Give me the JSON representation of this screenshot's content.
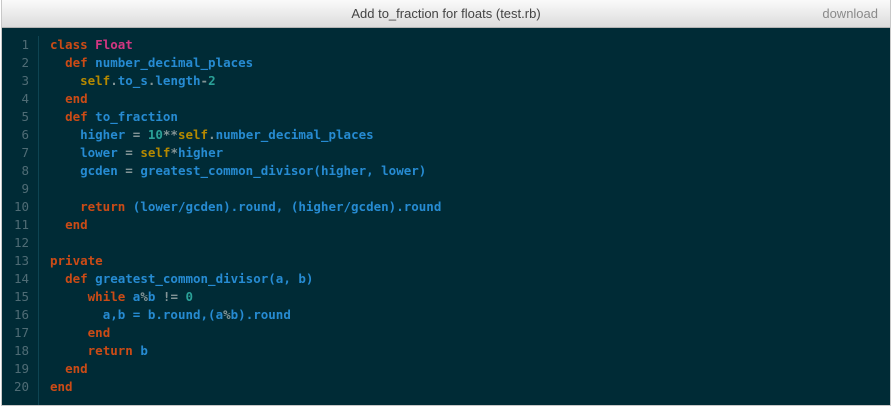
{
  "window": {
    "title": "Add to_fraction for floats (test.rb)",
    "download_label": "download"
  },
  "colors": {
    "background": "#002b36",
    "keyword": "#cb4b16",
    "class_name": "#d33682",
    "identifier": "#268bd2",
    "self": "#b58900",
    "number": "#2aa198",
    "line_number": "#4f6c75"
  },
  "line_numbers": [
    "1",
    "2",
    "3",
    "4",
    "5",
    "6",
    "7",
    "8",
    "9",
    "10",
    "11",
    "12",
    "13",
    "14",
    "15",
    "16",
    "17",
    "18",
    "19",
    "20"
  ],
  "code": {
    "lines": [
      [
        {
          "t": "class",
          "c": "kw"
        },
        {
          "t": " ",
          "c": "pl"
        },
        {
          "t": "Float",
          "c": "cls"
        }
      ],
      [
        {
          "t": "  ",
          "c": "pl"
        },
        {
          "t": "def",
          "c": "kw"
        },
        {
          "t": " ",
          "c": "pl"
        },
        {
          "t": "number_decimal_places",
          "c": "fn"
        }
      ],
      [
        {
          "t": "    ",
          "c": "pl"
        },
        {
          "t": "self",
          "c": "slf"
        },
        {
          "t": ".",
          "c": "op"
        },
        {
          "t": "to_s",
          "c": "id"
        },
        {
          "t": ".",
          "c": "op"
        },
        {
          "t": "length",
          "c": "id"
        },
        {
          "t": "-",
          "c": "op"
        },
        {
          "t": "2",
          "c": "num"
        }
      ],
      [
        {
          "t": "  ",
          "c": "pl"
        },
        {
          "t": "end",
          "c": "kw"
        }
      ],
      [
        {
          "t": "  ",
          "c": "pl"
        },
        {
          "t": "def",
          "c": "kw"
        },
        {
          "t": " ",
          "c": "pl"
        },
        {
          "t": "to_fraction",
          "c": "fn"
        }
      ],
      [
        {
          "t": "    ",
          "c": "pl"
        },
        {
          "t": "higher",
          "c": "id"
        },
        {
          "t": " = ",
          "c": "op"
        },
        {
          "t": "10",
          "c": "num"
        },
        {
          "t": "**",
          "c": "op"
        },
        {
          "t": "self",
          "c": "slf"
        },
        {
          "t": ".",
          "c": "op"
        },
        {
          "t": "number_decimal_places",
          "c": "id"
        }
      ],
      [
        {
          "t": "    ",
          "c": "pl"
        },
        {
          "t": "lower",
          "c": "id"
        },
        {
          "t": " = ",
          "c": "op"
        },
        {
          "t": "self",
          "c": "slf"
        },
        {
          "t": "*",
          "c": "op"
        },
        {
          "t": "higher",
          "c": "id"
        }
      ],
      [
        {
          "t": "    ",
          "c": "pl"
        },
        {
          "t": "gcden",
          "c": "id"
        },
        {
          "t": " = ",
          "c": "op"
        },
        {
          "t": "greatest_common_divisor(higher, lower)",
          "c": "id"
        }
      ],
      [],
      [
        {
          "t": "    ",
          "c": "pl"
        },
        {
          "t": "return",
          "c": "kw"
        },
        {
          "t": " (lower/gcden).round, (higher/gcden).round",
          "c": "id"
        }
      ],
      [
        {
          "t": "  ",
          "c": "pl"
        },
        {
          "t": "end",
          "c": "kw"
        }
      ],
      [],
      [
        {
          "t": "private",
          "c": "kw"
        }
      ],
      [
        {
          "t": "  ",
          "c": "pl"
        },
        {
          "t": "def",
          "c": "kw"
        },
        {
          "t": " ",
          "c": "pl"
        },
        {
          "t": "greatest_common_divisor",
          "c": "fn"
        },
        {
          "t": "(a, b)",
          "c": "id"
        }
      ],
      [
        {
          "t": "     ",
          "c": "pl"
        },
        {
          "t": "while",
          "c": "kw"
        },
        {
          "t": " a",
          "c": "id"
        },
        {
          "t": "%",
          "c": "op"
        },
        {
          "t": "b",
          "c": "id"
        },
        {
          "t": " != ",
          "c": "op"
        },
        {
          "t": "0",
          "c": "num"
        }
      ],
      [
        {
          "t": "       ",
          "c": "pl"
        },
        {
          "t": "a,b = b.round,(a",
          "c": "id"
        },
        {
          "t": "%",
          "c": "op"
        },
        {
          "t": "b).round",
          "c": "id"
        }
      ],
      [
        {
          "t": "     ",
          "c": "pl"
        },
        {
          "t": "end",
          "c": "kw"
        }
      ],
      [
        {
          "t": "     ",
          "c": "pl"
        },
        {
          "t": "return",
          "c": "kw"
        },
        {
          "t": " b",
          "c": "id"
        }
      ],
      [
        {
          "t": "  ",
          "c": "pl"
        },
        {
          "t": "end",
          "c": "kw"
        }
      ],
      [
        {
          "t": "end",
          "c": "kw"
        }
      ]
    ]
  }
}
